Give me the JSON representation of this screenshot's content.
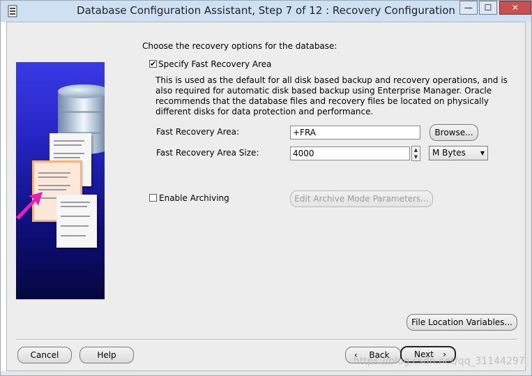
{
  "window": {
    "title": "Database Configuration Assistant, Step 7 of 12 : Recovery Configuration",
    "controls": {
      "minimize": "—",
      "maximize": "☐",
      "close": "✕"
    }
  },
  "content": {
    "intro": "Choose the recovery options for the database:",
    "fast_recovery": {
      "checkbox_label": "Specify Fast Recovery Area",
      "checked": true,
      "description": "This is used as the default for all disk based backup and recovery operations, and is also required for automatic disk based backup using Enterprise Manager. Oracle recommends that the database files and recovery files be located on physically different disks for data protection and performance.",
      "area_label": "Fast Recovery Area:",
      "area_value": "+FRA",
      "browse_label": "Browse...",
      "size_label": "Fast Recovery Area Size:",
      "size_value": "4000",
      "unit_value": "M Bytes"
    },
    "archiving": {
      "checkbox_label": "Enable Archiving",
      "checked": false,
      "edit_params_label": "Edit Archive Mode Parameters..."
    },
    "file_location_label": "File Location Variables..."
  },
  "footer": {
    "cancel_label": "Cancel",
    "help_label": "Help",
    "back_label": "Back",
    "next_label": "Next"
  },
  "watermark": "https://blog.csdn.net/qq_31144297",
  "colors": {
    "titlebar": "#cfe0f3",
    "panel_gradient_top": "#3a3ae6",
    "panel_gradient_bottom": "#060640",
    "arrow": "#e51fb8"
  }
}
